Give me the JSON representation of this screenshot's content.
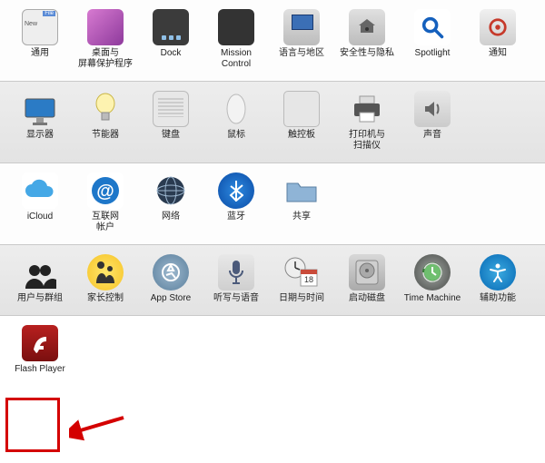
{
  "sections": {
    "personal": {
      "general": "通用",
      "desktop": "桌面与\n屏幕保护程序",
      "dock": "Dock",
      "mission": "Mission\nControl",
      "language": "语言与地区",
      "security": "安全性与隐私",
      "spotlight": "Spotlight",
      "notifications": "通知"
    },
    "hardware": {
      "displays": "显示器",
      "energy": "节能器",
      "keyboard": "键盘",
      "mouse": "鼠标",
      "trackpad": "触控板",
      "printers": "打印机与\n扫描仪",
      "sound": "声音"
    },
    "internet": {
      "icloud": "iCloud",
      "accounts": "互联网\n帐户",
      "network": "网络",
      "bluetooth": "蓝牙",
      "sharing": "共享"
    },
    "system": {
      "users": "用户与群组",
      "parental": "家长控制",
      "appstore": "App Store",
      "dictation": "听写与语音",
      "datetime": "日期与时间",
      "startup": "启动磁盘",
      "timemachine": "Time Machine",
      "accessibility": "辅助功能"
    },
    "other": {
      "flash": "Flash Player"
    }
  },
  "calendar_day": "18"
}
